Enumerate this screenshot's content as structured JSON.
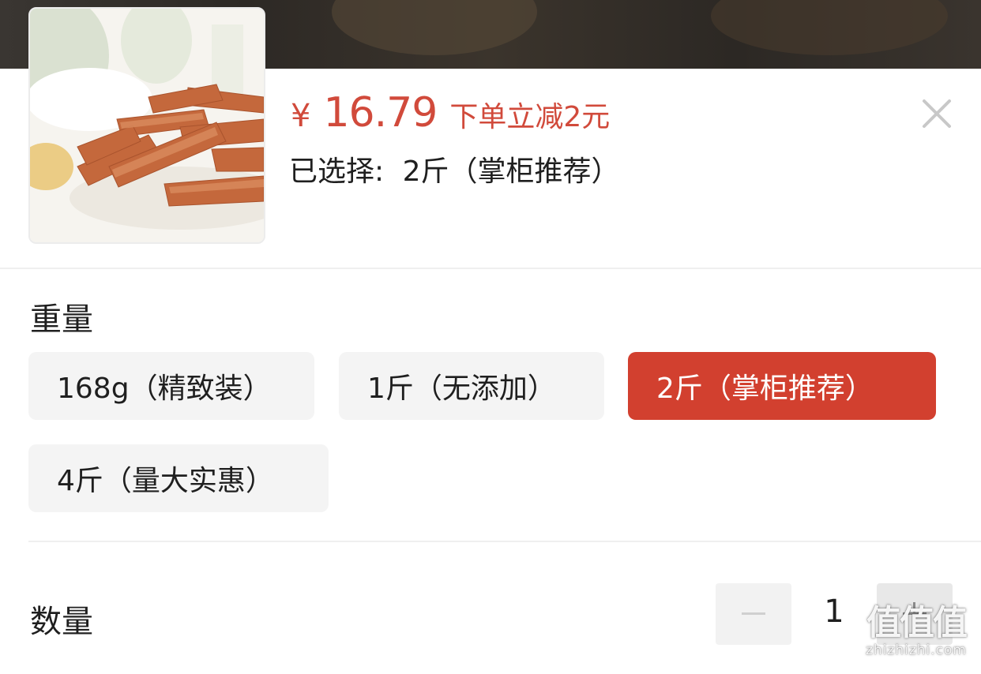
{
  "product": {
    "image_icon": "brown-sugar-product-photo",
    "currency_symbol": "¥",
    "price": "16.79",
    "discount_text": "下单立减2元",
    "selected_label": "已选择:",
    "selected_value": "2斤（掌柜推荐）"
  },
  "close_icon": "close-icon",
  "weight": {
    "label": "重量",
    "options": [
      {
        "label": "168g（精致装）",
        "selected": false
      },
      {
        "label": "1斤（无添加）",
        "selected": false
      },
      {
        "label": "2斤（掌柜推荐）",
        "selected": true
      },
      {
        "label": "4斤（量大实惠）",
        "selected": false
      }
    ]
  },
  "quantity": {
    "label": "数量",
    "value": "1",
    "decrease_icon": "minus-icon",
    "increase_icon": "plus-icon"
  },
  "watermark": {
    "mark": "值值值",
    "site": "zhizhizhi.com"
  },
  "colors": {
    "accent": "#d2402f",
    "price_red": "#d14a3b",
    "option_bg": "#f4f4f4"
  }
}
